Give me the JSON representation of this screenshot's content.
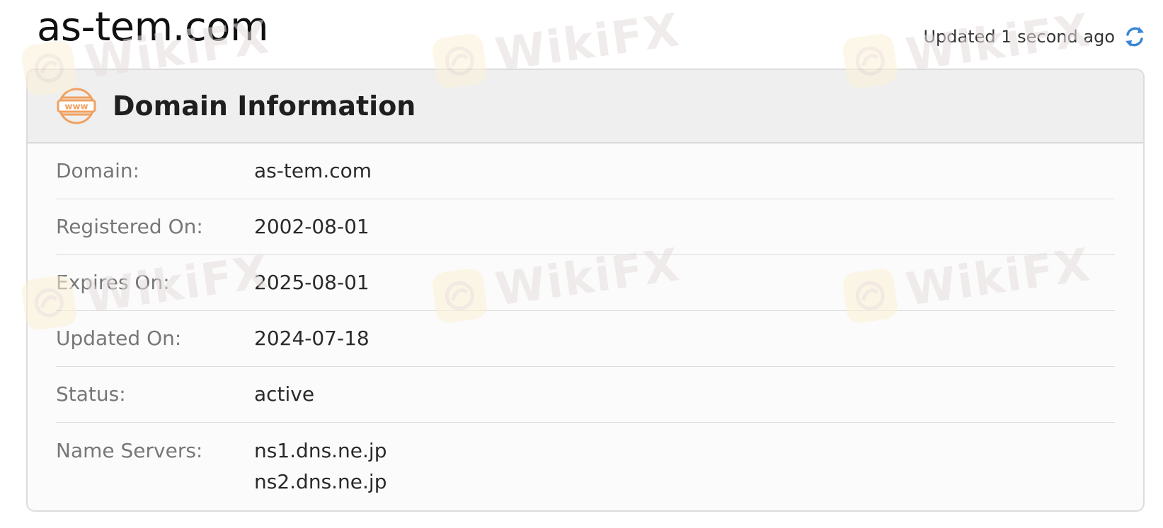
{
  "header": {
    "site_title": "as-tem.com",
    "updated_text": "Updated 1 second ago"
  },
  "card": {
    "title": "Domain Information",
    "icon_text": "www",
    "rows": [
      {
        "label": "Domain:",
        "value": "as-tem.com"
      },
      {
        "label": "Registered On:",
        "value": "2002-08-01"
      },
      {
        "label": "Expires On:",
        "value": "2025-08-01"
      },
      {
        "label": "Updated On:",
        "value": "2024-07-18"
      },
      {
        "label": "Status:",
        "value": "active"
      }
    ],
    "name_servers": {
      "label": "Name Servers:",
      "values": [
        "ns1.dns.ne.jp",
        "ns2.dns.ne.jp"
      ]
    }
  },
  "watermark": {
    "text": "WikiFX"
  },
  "colors": {
    "accent_orange": "#f0a060",
    "refresh_blue": "#3a86d6",
    "watermark_text": "#e6dede",
    "watermark_logo_bg": "#fbf1d6"
  }
}
